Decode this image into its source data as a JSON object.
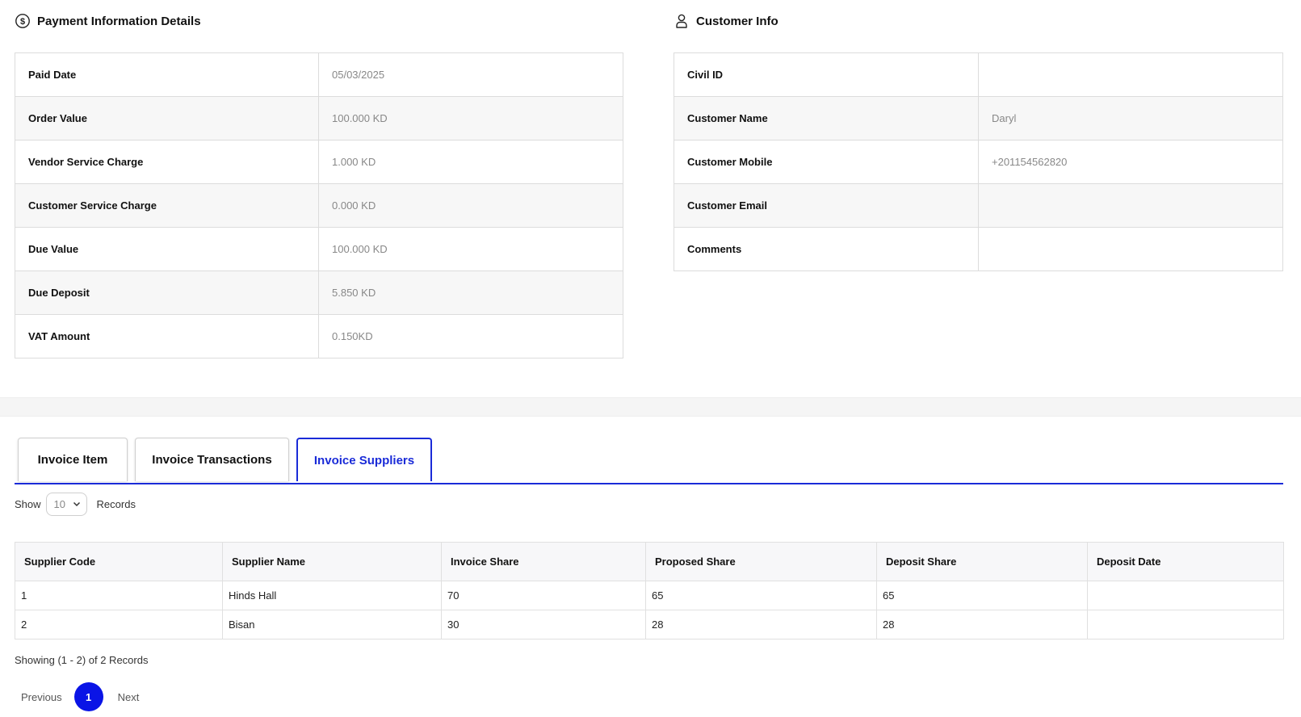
{
  "payment": {
    "title": "Payment Information Details",
    "icon": "dollar-circle-icon",
    "rows": [
      {
        "label": "Paid Date",
        "value": "05/03/2025"
      },
      {
        "label": "Order Value",
        "value": "100.000 KD"
      },
      {
        "label": "Vendor Service Charge",
        "value": "1.000 KD"
      },
      {
        "label": "Customer Service Charge",
        "value": "0.000 KD"
      },
      {
        "label": "Due Value",
        "value": "100.000 KD"
      },
      {
        "label": "Due Deposit",
        "value": "5.850 KD"
      },
      {
        "label": "VAT Amount",
        "value": "0.150KD"
      }
    ]
  },
  "customer": {
    "title": "Customer Info",
    "icon": "user-icon",
    "rows": [
      {
        "label": "Civil ID",
        "value": ""
      },
      {
        "label": "Customer Name",
        "value": "Daryl"
      },
      {
        "label": "Customer Mobile",
        "value": "+201154562820"
      },
      {
        "label": "Customer Email",
        "value": ""
      },
      {
        "label": "Comments",
        "value": ""
      }
    ]
  },
  "tabs": [
    {
      "label": "Invoice Item",
      "active": false
    },
    {
      "label": "Invoice Transactions",
      "active": false
    },
    {
      "label": "Invoice Suppliers",
      "active": true
    }
  ],
  "records_control": {
    "show_label": "Show",
    "selected": "10",
    "records_label": "Records"
  },
  "suppliers_table": {
    "columns": [
      "Supplier Code",
      "Supplier Name",
      "Invoice Share",
      "Proposed Share",
      "Deposit Share",
      "Deposit Date"
    ],
    "rows": [
      [
        "1",
        "Hinds Hall",
        "70",
        "65",
        "65",
        ""
      ],
      [
        "2",
        "Bisan",
        "30",
        "28",
        "28",
        ""
      ]
    ]
  },
  "footer": {
    "showing": "Showing (1 - 2) of 2 Records",
    "previous": "Previous",
    "page": "1",
    "next": "Next"
  },
  "colors": {
    "accent": "#1a2bd8",
    "page_active": "#0a14e6"
  }
}
